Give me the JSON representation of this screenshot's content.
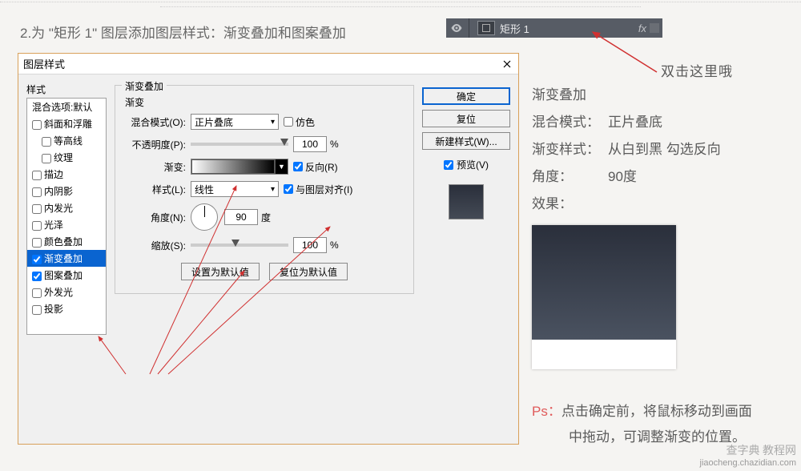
{
  "instruction": "2.为 \"矩形 1\" 图层添加图层样式：渐变叠加和图案叠加",
  "layer_panel": {
    "layer_name": "矩形 1",
    "fx": "fx"
  },
  "note_dbl": "双击这里哦",
  "notes": {
    "title": "渐变叠加",
    "rows": [
      {
        "k": "混合模式：",
        "v": "正片叠底"
      },
      {
        "k": "渐变样式：",
        "v": "从白到黑 勾选反向"
      },
      {
        "k": "角度：",
        "v": "90度"
      },
      {
        "k": "效果：",
        "v": ""
      }
    ]
  },
  "ps_note": {
    "ps": "Ps：",
    "line1": "点击确定前，将鼠标移动到画面",
    "line2": "中拖动，可调整渐变的位置。"
  },
  "dialog": {
    "title": "图层样式",
    "styles_label": "样式",
    "styles": [
      {
        "label": "混合选项:默认",
        "checkable": false
      },
      {
        "label": "斜面和浮雕",
        "checkable": true,
        "checked": false
      },
      {
        "label": "等高线",
        "checkable": true,
        "checked": false,
        "sub": true
      },
      {
        "label": "纹理",
        "checkable": true,
        "checked": false,
        "sub": true
      },
      {
        "label": "描边",
        "checkable": true,
        "checked": false
      },
      {
        "label": "内阴影",
        "checkable": true,
        "checked": false
      },
      {
        "label": "内发光",
        "checkable": true,
        "checked": false
      },
      {
        "label": "光泽",
        "checkable": true,
        "checked": false
      },
      {
        "label": "颜色叠加",
        "checkable": true,
        "checked": false
      },
      {
        "label": "渐变叠加",
        "checkable": true,
        "checked": true,
        "selected": true
      },
      {
        "label": "图案叠加",
        "checkable": true,
        "checked": true
      },
      {
        "label": "外发光",
        "checkable": true,
        "checked": false
      },
      {
        "label": "投影",
        "checkable": true,
        "checked": false
      }
    ],
    "section_title": "渐变叠加",
    "section_sub": "渐变",
    "blend_label": "混合模式(O):",
    "blend_value": "正片叠底",
    "dither_label": "仿色",
    "opacity_label": "不透明度(P):",
    "opacity_value": "100",
    "pct": "%",
    "gradient_label": "渐变:",
    "reverse_label": "反向(R)",
    "style_label": "样式(L):",
    "style_value": "线性",
    "align_label": "与图层对齐(I)",
    "angle_label": "角度(N):",
    "angle_value": "90",
    "angle_unit": "度",
    "scale_label": "缩放(S):",
    "scale_value": "100",
    "set_default": "设置为默认值",
    "reset_default": "复位为默认值",
    "ok": "确定",
    "cancel": "复位",
    "new_style": "新建样式(W)...",
    "preview_label": "预览(V)"
  },
  "watermark": {
    "l1": "查字典 教程网",
    "l2": "jiaocheng.chazidian.com"
  }
}
